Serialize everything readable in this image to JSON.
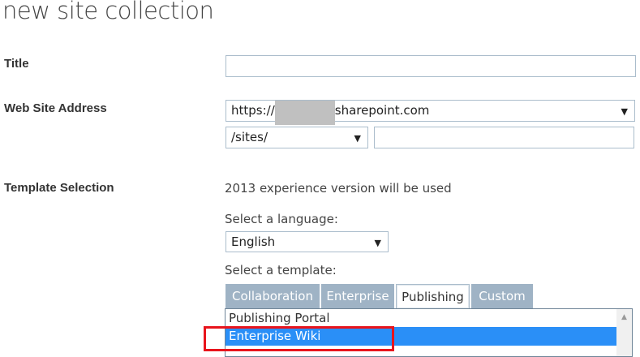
{
  "page_title": "new site collection",
  "title": {
    "label": "Title",
    "value": ""
  },
  "web_address": {
    "label": "Web Site Address",
    "domain": "https://sharepoint.com",
    "domain_prefix": "https://",
    "domain_suffix": "sharepoint.com",
    "path": "/sites/",
    "name": ""
  },
  "template": {
    "label": "Template Selection",
    "version_note": "2013 experience version will be used",
    "language_label": "Select a language:",
    "language": "English",
    "template_label": "Select a template:",
    "tabs": [
      "Collaboration",
      "Enterprise",
      "Publishing",
      "Custom"
    ],
    "items": [
      "Publishing Portal",
      "Enterprise Wiki"
    ]
  },
  "colors": {
    "selected": "#2a8ff7",
    "highlight": "#e8141c",
    "tab": "#9fb3c5"
  }
}
